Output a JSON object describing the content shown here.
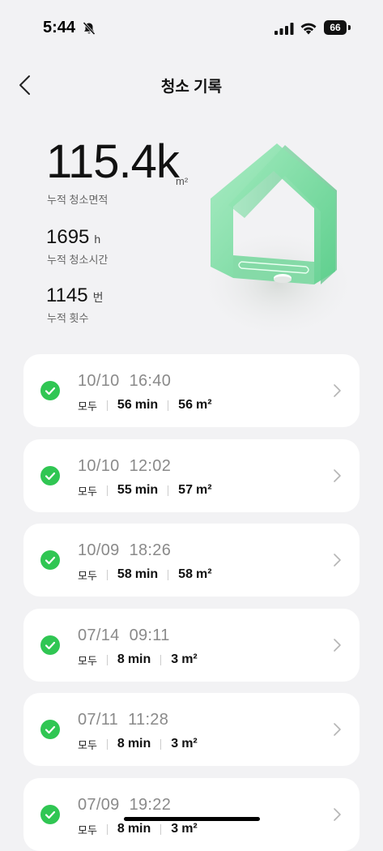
{
  "status_bar": {
    "time": "5:44",
    "battery": "66"
  },
  "header": {
    "title": "청소 기록"
  },
  "summary": {
    "area_value": "115.4k",
    "area_unit": "m²",
    "area_label": "누적 청소면적",
    "time_value": "1695",
    "time_unit": "h",
    "time_label": "누적 청소시간",
    "count_value": "1145",
    "count_unit": "번",
    "count_label": "누적 횟수"
  },
  "records": [
    {
      "date": "10/10",
      "time": "16:40",
      "mode": "모두",
      "duration": "56",
      "duration_unit": "min",
      "area": "56",
      "area_unit": "m²"
    },
    {
      "date": "10/10",
      "time": "12:02",
      "mode": "모두",
      "duration": "55",
      "duration_unit": "min",
      "area": "57",
      "area_unit": "m²"
    },
    {
      "date": "10/09",
      "time": "18:26",
      "mode": "모두",
      "duration": "58",
      "duration_unit": "min",
      "area": "58",
      "area_unit": "m²"
    },
    {
      "date": "07/14",
      "time": "09:11",
      "mode": "모두",
      "duration": "8",
      "duration_unit": "min",
      "area": "3",
      "area_unit": "m²"
    },
    {
      "date": "07/11",
      "time": "11:28",
      "mode": "모두",
      "duration": "8",
      "duration_unit": "min",
      "area": "3",
      "area_unit": "m²"
    },
    {
      "date": "07/09",
      "time": "19:22",
      "mode": "모두",
      "duration": "8",
      "duration_unit": "min",
      "area": "3",
      "area_unit": "m²"
    }
  ],
  "colors": {
    "success_green": "#30c653",
    "card_bg": "#ffffff",
    "page_bg": "#f2f2f4"
  }
}
